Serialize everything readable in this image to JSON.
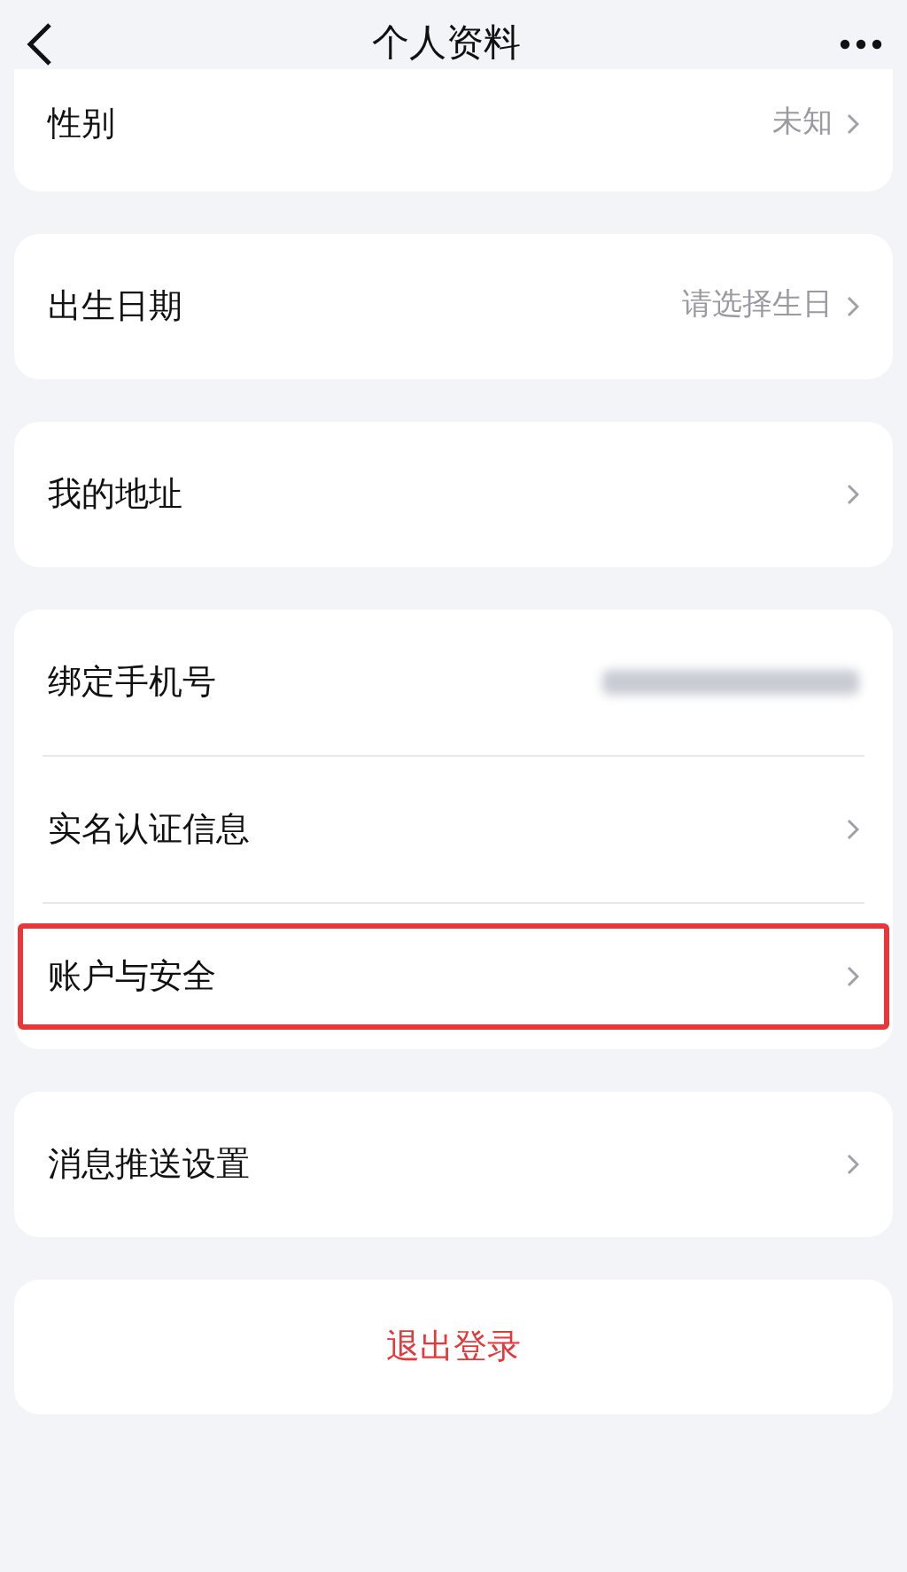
{
  "header": {
    "title": "个人资料"
  },
  "groups": [
    {
      "rows": [
        {
          "label": "性别",
          "value": "未知",
          "kind": "link",
          "highlighted": false
        }
      ]
    },
    {
      "rows": [
        {
          "label": "出生日期",
          "value": "请选择生日",
          "kind": "link",
          "highlighted": false
        }
      ]
    },
    {
      "rows": [
        {
          "label": "我的地址",
          "kind": "link",
          "highlighted": false
        }
      ]
    },
    {
      "rows": [
        {
          "label": "绑定手机号",
          "kind": "masked",
          "highlighted": false
        },
        {
          "label": "实名认证信息",
          "kind": "link",
          "highlighted": false
        },
        {
          "label": "账户与安全",
          "kind": "link",
          "highlighted": true
        }
      ]
    },
    {
      "rows": [
        {
          "label": "消息推送设置",
          "kind": "link",
          "highlighted": false
        }
      ]
    }
  ],
  "logout": {
    "label": "退出登录"
  }
}
